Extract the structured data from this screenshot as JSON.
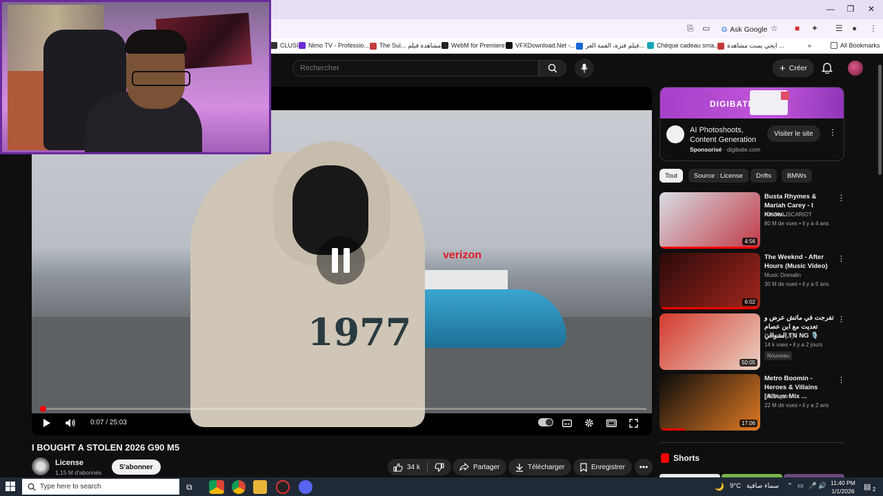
{
  "browser": {
    "ask_google": "Ask Google",
    "bookmarks": [
      {
        "label": "CLUSI...",
        "color": "#333333"
      },
      {
        "label": "Nimo TV - Professio...",
        "color": "#6a2bd6"
      },
      {
        "label": "The Sui... مشاهدة فيلم",
        "color": "#c23b3b"
      },
      {
        "label": "WebM for Premiere",
        "color": "#222222"
      },
      {
        "label": "VFXDownload.Net -...",
        "color": "#111111"
      },
      {
        "label": "فيلم فترة، القمة العر...",
        "color": "#1a66d9"
      },
      {
        "label": "Chèque cadeau sma...",
        "color": "#1aa3b8"
      },
      {
        "label": "ايجي بست مشاهدة ...",
        "color": "#c23b3b"
      }
    ],
    "all_bookmarks": "All Bookmarks"
  },
  "header": {
    "search_placeholder": "Rechercher",
    "create_label": "Créer"
  },
  "player": {
    "time": "0:07 / 25:03",
    "progress_fraction": 0.0047
  },
  "video": {
    "title": "I BOUGHT A STOLEN 2026 G90 M5",
    "jersey_text": "1977",
    "sign_text": "verizon",
    "channel": "License",
    "subscribers": "1,15 M d'abonnés",
    "subscribe_label": "S'abonner",
    "likes": "34 k",
    "share_label": "Partager",
    "download_label": "Télécharger",
    "save_label": "Enregistrer"
  },
  "ad": {
    "brand": "DIGIBATE",
    "title": "AI Photoshoots, Content Generation",
    "sponsored": "Sponsorisé",
    "domain": "digibate.com",
    "visit_label": "Visiter le site"
  },
  "chips": [
    "Tout",
    "Source : License",
    "Drifts",
    "BMWs"
  ],
  "recommendations": [
    {
      "title": "Busta Rhymes & Mariah Carey - I Know...",
      "channel": "NIKOLA ISCARIOT",
      "meta": "80 M de vues • il y a 4 ans",
      "duration": "4:56",
      "badge": "",
      "progress": 1.0,
      "thumb_colors": [
        "#d7dce3",
        "#c13a46"
      ]
    },
    {
      "title": "The Weeknd - After Hours (Music Video)",
      "channel": "Music Drenalin",
      "meta": "30 M de vues • il y a 5 ans",
      "duration": "6:02",
      "badge": "",
      "progress": 1.0,
      "thumb_colors": [
        "#2a0a0a",
        "#a3261c"
      ]
    },
    {
      "title": "تفرجت في ماتش عرض و تعديت مع ابن عصام الشوالي TN NG 🎙️",
      "channel": "Parker • باركر",
      "meta": "14 k vues • il y a 2 jours",
      "duration": "50:05",
      "badge": "Nouveau",
      "progress": 0.0,
      "thumb_colors": [
        "#d43a2e",
        "#e9d2c4"
      ]
    },
    {
      "title": "Metro Boomin - Heroes & Villains [Album Mix ...",
      "channel": "SBDAgain",
      "meta": "22 M de vues • il y a 2 ans",
      "duration": "17:06",
      "badge": "",
      "progress": 0.25,
      "thumb_colors": [
        "#0c0c0c",
        "#e07a24"
      ]
    }
  ],
  "shorts": {
    "title": "Shorts"
  },
  "taskbar": {
    "search_placeholder": "Type here to search",
    "weather": "9°C",
    "weather_text": "سماء صافية",
    "time": "11:40 PM",
    "date": "1/1/2026",
    "notification_count": "2"
  }
}
